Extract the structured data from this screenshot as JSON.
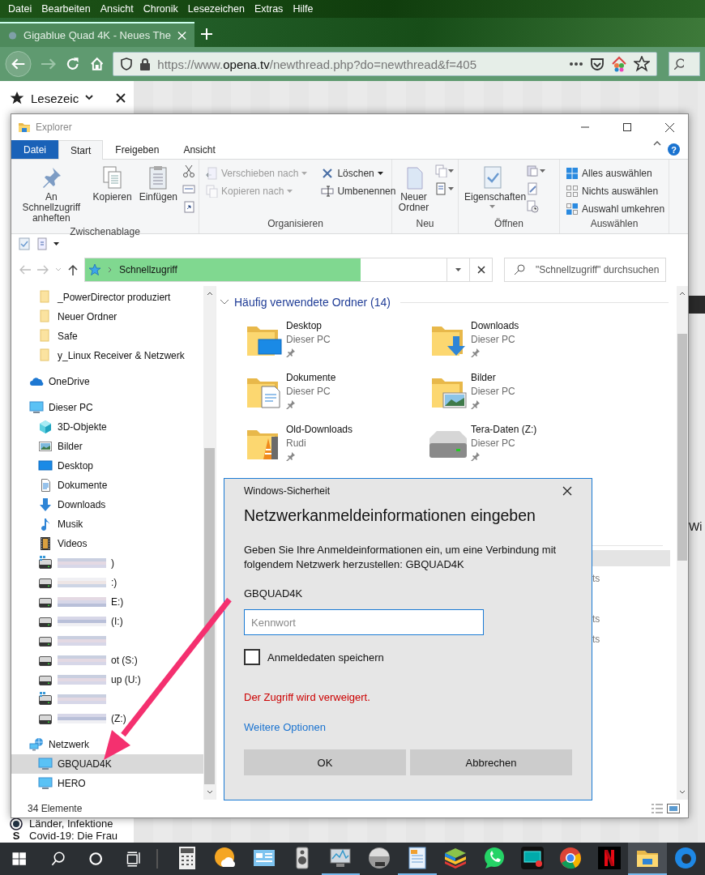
{
  "browser": {
    "menu": [
      "Datei",
      "Bearbeiten",
      "Ansicht",
      "Chronik",
      "Lesezeichen",
      "Extras",
      "Hilfe"
    ],
    "tabs": [
      {
        "title": "Gigablue Quad 4K - Neues The",
        "selected": true
      }
    ],
    "forward_enabled": false,
    "url": {
      "prefix": "https://www.",
      "domain": "opena.tv",
      "path": "/newthread.php?do=newthread&f=405"
    },
    "sidebar": {
      "title": "Lesezeic",
      "links": [
        {
          "title": "Länder, Infektione"
        },
        {
          "badge": "S",
          "title": "Covid-19: Die Frau"
        }
      ]
    },
    "page_text": "Wi"
  },
  "explorer": {
    "title": "Explorer",
    "ribbon_tabs": [
      {
        "label": "Datei",
        "kind": "file",
        "selected": false
      },
      {
        "label": "Start",
        "kind": "tab",
        "selected": true
      },
      {
        "label": "Freigeben",
        "kind": "tab",
        "selected": false
      },
      {
        "label": "Ansicht",
        "kind": "tab",
        "selected": false
      }
    ],
    "help": "?",
    "ribbon_groups": [
      {
        "name": "Zwischenablage",
        "commands": [
          {
            "label": "An Schnellzugriff anheften",
            "kind": "large",
            "dropdown": false,
            "disabled": false
          },
          {
            "label": "Kopieren",
            "kind": "large",
            "dropdown": false,
            "disabled": false
          },
          {
            "label": "Einfügen",
            "kind": "large",
            "dropdown": false,
            "disabled": false
          }
        ]
      },
      {
        "name": "Organisieren",
        "commands": [
          {
            "label": "Verschieben nach",
            "kind": "small",
            "dropdown": true,
            "disabled": true
          },
          {
            "label": "Kopieren nach",
            "kind": "small",
            "dropdown": true,
            "disabled": true
          },
          {
            "label": "Löschen",
            "kind": "small",
            "dropdown": true,
            "disabled": false
          },
          {
            "label": "Umbenennen",
            "kind": "small",
            "dropdown": false,
            "disabled": false
          }
        ]
      },
      {
        "name": "Neu",
        "commands": [
          {
            "label": "Neuer Ordner",
            "kind": "large",
            "dropdown": false,
            "disabled": false
          }
        ]
      },
      {
        "name": "Öffnen",
        "commands": [
          {
            "label": "Eigenschaften",
            "kind": "large",
            "dropdown": true,
            "disabled": false
          }
        ]
      },
      {
        "name": "Auswählen",
        "commands": [
          {
            "label": "Alles auswählen",
            "kind": "small",
            "dropdown": false,
            "disabled": false
          },
          {
            "label": "Nichts auswählen",
            "kind": "small",
            "dropdown": false,
            "disabled": false
          },
          {
            "label": "Auswahl umkehren",
            "kind": "small",
            "dropdown": false,
            "disabled": false
          }
        ]
      }
    ],
    "address": {
      "crumb": "Schnellzugriff"
    },
    "search": {
      "placeholder": "\"Schnellzugriff\" durchsuchen"
    },
    "quick_access_items": [
      {
        "label": "_PowerDirector produziert",
        "selected": false
      },
      {
        "label": "Neuer Ordner",
        "selected": false
      },
      {
        "label": "Safe",
        "selected": false
      },
      {
        "label": "y_Linux Receiver & Netzwerk",
        "selected": false
      }
    ],
    "nav_tree": [
      {
        "label": "OneDrive",
        "selected": false
      },
      {
        "label": "Dieser PC",
        "selected": false,
        "children": [
          {
            "label": "3D-Objekte",
            "selected": false,
            "redacted": false
          },
          {
            "label": "Bilder",
            "selected": false,
            "redacted": false
          },
          {
            "label": "Desktop",
            "selected": false,
            "redacted": false
          },
          {
            "label": "Dokumente",
            "selected": false,
            "redacted": false
          },
          {
            "label": "Downloads",
            "selected": false,
            "redacted": false
          },
          {
            "label": "Musik",
            "selected": false,
            "redacted": false
          },
          {
            "label": "Videos",
            "selected": false,
            "redacted": false
          },
          {
            "label": ")",
            "selected": false,
            "redacted": true
          },
          {
            "label": ":)",
            "selected": false,
            "redacted": true
          },
          {
            "label": "E:)",
            "selected": false,
            "redacted": true
          },
          {
            "label": "(I:)",
            "selected": false,
            "redacted": true
          },
          {
            "selected": false,
            "redacted": true
          },
          {
            "label": "ot (S:)",
            "selected": false,
            "redacted": true
          },
          {
            "label": "up (U:)",
            "selected": false,
            "redacted": true
          },
          {
            "selected": false,
            "redacted": true
          },
          {
            "label": "(Z:)",
            "selected": false,
            "redacted": true
          }
        ]
      },
      {
        "label": "Netzwerk",
        "selected": false,
        "children": [
          {
            "label": "GBQUAD4K",
            "selected": true
          },
          {
            "label": "HERO",
            "selected": false
          }
        ]
      }
    ],
    "section": {
      "title": "Häufig verwendete Ordner (14)",
      "expanded": true,
      "tiles": [
        {
          "name": "Desktop",
          "location": "Dieser PC",
          "pinned": true
        },
        {
          "name": "Downloads",
          "location": "Dieser PC",
          "pinned": true
        },
        {
          "name": "Dokumente",
          "location": "Dieser PC",
          "pinned": true
        },
        {
          "name": "Bilder",
          "location": "Dieser PC",
          "pinned": true
        },
        {
          "name": "Old-Downloads",
          "location": "Rudi",
          "pinned": true
        },
        {
          "name": "Tera-Daten (Z:)",
          "location": "Dieser PC",
          "pinned": true
        }
      ]
    },
    "recent_files": [
      {
        "name": "ts"
      },
      {
        "name": "ts"
      },
      {
        "name": "ts"
      }
    ],
    "status": "34 Elemente"
  },
  "dialog": {
    "caption": "Windows-Sicherheit",
    "heading": "Netzwerkanmeldeinformationen eingeben",
    "message": "Geben Sie Ihre Anmeldeinformationen ein, um eine Verbindung mit folgendem Netzwerk herzustellen: GBQUAD4K",
    "user": "GBQUAD4K",
    "password": {
      "placeholder": "Kennwort"
    },
    "remember": {
      "label": "Anmeldedaten speichern",
      "checked": false
    },
    "error": "Der Zugriff wird verweigert.",
    "link": "Weitere Optionen",
    "buttons": [
      "OK",
      "Abbrechen"
    ]
  },
  "taskbar": {
    "apps": [
      {
        "running": false,
        "active": false
      },
      {
        "running": false,
        "active": false
      },
      {
        "running": false,
        "active": false
      },
      {
        "running": false,
        "active": false
      },
      {
        "running": true,
        "active": false
      },
      {
        "running": false,
        "active": false
      },
      {
        "running": true,
        "active": false
      },
      {
        "running": false,
        "active": false
      },
      {
        "running": false,
        "active": false
      },
      {
        "running": false,
        "active": false
      },
      {
        "running": false,
        "active": false
      },
      {
        "running": false,
        "active": false
      },
      {
        "running": true,
        "active": true
      },
      {
        "running": false,
        "active": false
      }
    ]
  }
}
